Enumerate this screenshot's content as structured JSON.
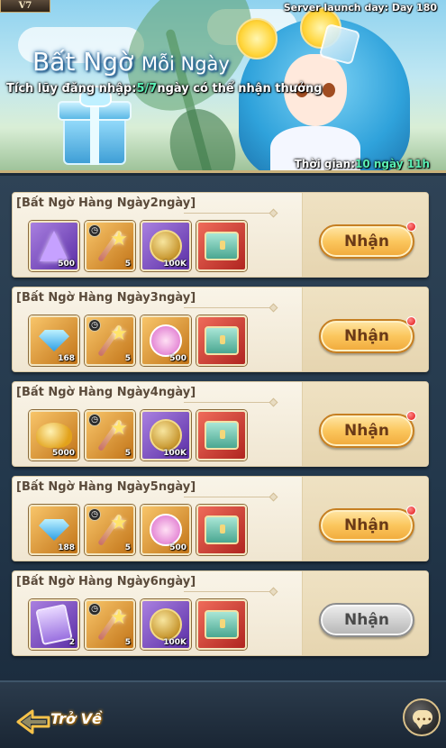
{
  "header": {
    "vip_label": "V7",
    "server_day": "Server launch day: Day 180",
    "title_main": "Bất Ngờ",
    "title_small": "Mỗi Ngày",
    "subtitle_prefix": "Tích lũy đăng nhập:",
    "subtitle_highlight": "5/7",
    "subtitle_suffix": "ngày có thể nhận thưởng",
    "time_label": "Thời gian:",
    "time_value": "10 ngày 11h"
  },
  "rewards": [
    {
      "title": "[Bất Ngờ Hàng Ngày2ngày]",
      "button": "Nhận",
      "has_red_dot": true,
      "claimable": true,
      "items": [
        {
          "icon": "purple-crystal-icon",
          "qty": "500",
          "timed": false
        },
        {
          "icon": "star-wand-icon",
          "qty": "5",
          "timed": true
        },
        {
          "icon": "gold-coin-icon",
          "qty": "100K",
          "timed": false
        },
        {
          "icon": "treasure-chest-icon",
          "qty": "",
          "timed": false
        }
      ]
    },
    {
      "title": "[Bất Ngờ Hàng Ngày3ngày]",
      "button": "Nhận",
      "has_red_dot": true,
      "claimable": true,
      "items": [
        {
          "icon": "blue-diamond-icon",
          "qty": "168",
          "timed": false
        },
        {
          "icon": "star-wand-icon",
          "qty": "5",
          "timed": true
        },
        {
          "icon": "winged-emblem-icon",
          "qty": "500",
          "timed": false
        },
        {
          "icon": "treasure-chest-icon",
          "qty": "",
          "timed": false
        }
      ]
    },
    {
      "title": "[Bất Ngờ Hàng Ngày4ngày]",
      "button": "Nhận",
      "has_red_dot": true,
      "claimable": true,
      "items": [
        {
          "icon": "gold-pile-icon",
          "qty": "5000",
          "timed": false
        },
        {
          "icon": "star-wand-icon",
          "qty": "5",
          "timed": true
        },
        {
          "icon": "gold-coin-icon",
          "qty": "100K",
          "timed": false
        },
        {
          "icon": "treasure-chest-icon",
          "qty": "",
          "timed": false
        }
      ]
    },
    {
      "title": "[Bất Ngờ Hàng Ngày5ngày]",
      "button": "Nhận",
      "has_red_dot": true,
      "claimable": true,
      "items": [
        {
          "icon": "blue-diamond-icon",
          "qty": "188",
          "timed": false
        },
        {
          "icon": "star-wand-icon",
          "qty": "5",
          "timed": true
        },
        {
          "icon": "winged-emblem-icon",
          "qty": "500",
          "timed": false
        },
        {
          "icon": "treasure-chest-icon",
          "qty": "",
          "timed": false
        }
      ]
    },
    {
      "title": "[Bất Ngờ Hàng Ngày6ngày]",
      "button": "Nhận",
      "has_red_dot": false,
      "claimable": false,
      "items": [
        {
          "icon": "magic-scroll-icon",
          "qty": "2",
          "timed": false
        },
        {
          "icon": "star-wand-icon",
          "qty": "5",
          "timed": true
        },
        {
          "icon": "gold-coin-icon",
          "qty": "100K",
          "timed": false
        },
        {
          "icon": "treasure-chest-icon",
          "qty": "",
          "timed": false
        }
      ]
    }
  ],
  "footer": {
    "back_label": "Trở Về",
    "chat_icon": "chat-bubble-icon"
  },
  "colors": {
    "accent_green": "#5af0b4",
    "button_gold": "#fbc65d",
    "button_disabled": "#cfcfcf"
  }
}
